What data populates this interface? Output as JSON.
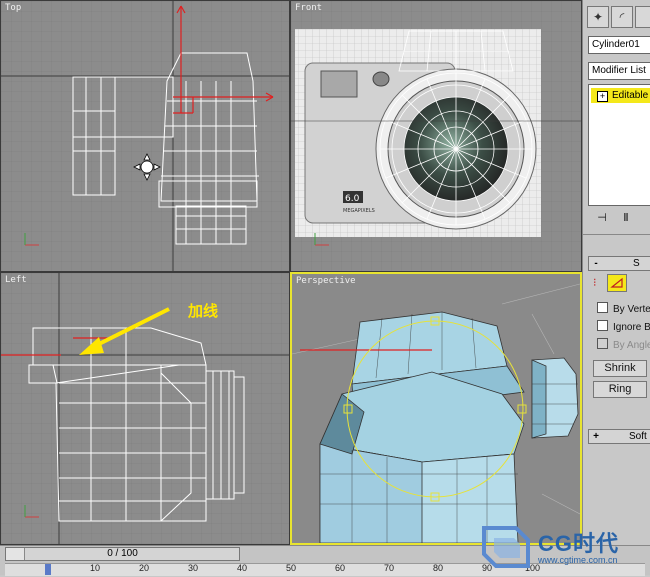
{
  "viewports": {
    "top": {
      "label": "Top"
    },
    "front": {
      "label": "Front",
      "badge": "6.0",
      "caption": "MEGAPIXELS"
    },
    "left": {
      "label": "Left",
      "annotation": "加线"
    },
    "perspective": {
      "label": "Perspective"
    }
  },
  "command_panel": {
    "tabs": [
      {
        "name": "create-tab",
        "glyph": "✦"
      },
      {
        "name": "modify-tab",
        "glyph": "◜"
      }
    ],
    "object_name": "Cylinder01",
    "modifier_list": "Modifier List",
    "stack_item": "Editable P",
    "pin_glyph": "⊣",
    "show_glyph": "Ⅱ",
    "selection_rollout": {
      "sign": "-",
      "title": "S"
    },
    "checkboxes": [
      {
        "label": "By Verte",
        "enabled": true
      },
      {
        "label": "Ignore B",
        "enabled": true
      },
      {
        "label": "By Angle",
        "enabled": false
      }
    ],
    "shrink_label": "Shrink",
    "ring_label": "Ring",
    "soft_rollout": {
      "sign": "+",
      "title": "Soft"
    }
  },
  "timeline": {
    "frame_label": "0 / 100",
    "ticks": [
      "10",
      "20",
      "30",
      "40",
      "50",
      "60",
      "70",
      "80",
      "90",
      "100"
    ]
  },
  "watermark": {
    "text": "CG时代",
    "url": "www.cgtime.com.cn"
  },
  "colors": {
    "active_viewport": "#e8e430",
    "model_shade": "#a8d4e4",
    "stack_highlight": "#f4e81a"
  }
}
